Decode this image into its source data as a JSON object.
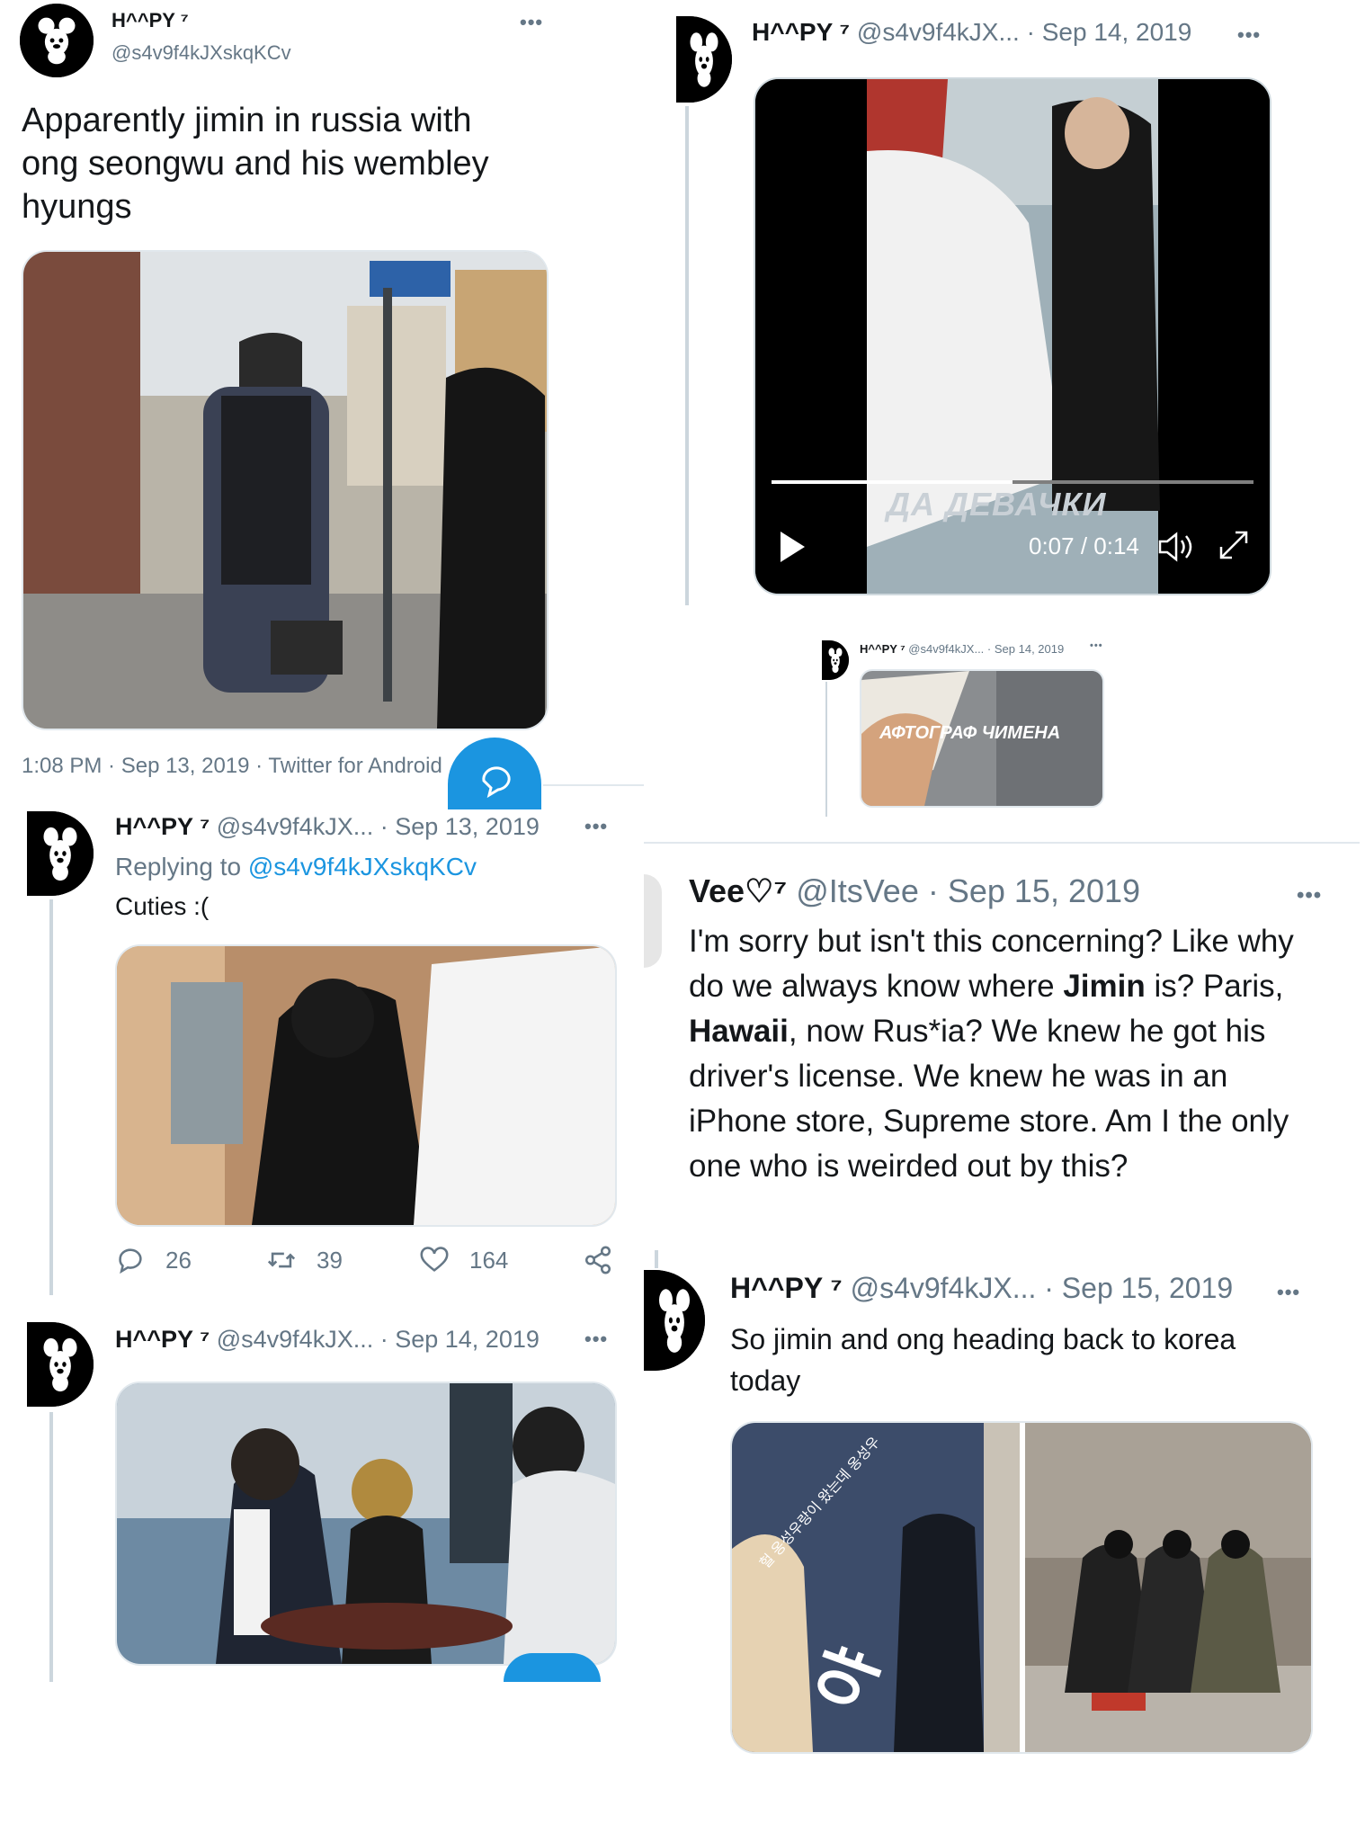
{
  "tweet_main": {
    "display_name": "H^^PY ⁷",
    "handle": "@s4v9f4kJXskqKCv",
    "text_lines": [
      "Apparently jimin in russia with",
      "ong seongwu and his wembley",
      "hyungs"
    ],
    "meta": "1:08 PM · Sep 13, 2019 · Twitter for Android"
  },
  "reply_1": {
    "display_name": "H^^PY ⁷",
    "handle": "@s4v9f4kJX...",
    "date": "· Sep 13, 2019",
    "replying_prefix": "Replying to",
    "replying_handle": "@s4v9f4kJXskqKCv",
    "text": "Cuties :(",
    "replies": "26",
    "retweets": "39",
    "likes": "164"
  },
  "reply_2": {
    "display_name": "H^^PY ⁷",
    "handle": "@s4v9f4kJX...",
    "date": "· Sep 14, 2019"
  },
  "video_tweet": {
    "display_name": "H^^PY ⁷",
    "handle": "@s4v9f4kJX...",
    "date": "· Sep 14, 2019",
    "caption": "ДА ДЕВАЧКИ",
    "time": "0:07 / 0:14",
    "progress": 0.5
  },
  "small_tweet": {
    "header": "H^^PY ⁷",
    "handle": "@s4v9f4kJX...",
    "date": "· Sep 14, 2019",
    "caption": "АФТОГРАФ ЧИМЕНА"
  },
  "vee_tweet": {
    "display_name": "Vee♡⁷",
    "handle": "@ItsVee",
    "date": "· Sep 15, 2019",
    "l1": "I'm sorry but isn't this concerning? Like why",
    "l2_a": "do we always know where ",
    "l2_b": "Jimin",
    "l2_c": " is? Paris,",
    "l3_a": "Hawaii",
    "l3_b": ", now Rus*ia? We knew he got his",
    "l4": "driver's license. We knew he was in an",
    "l5": "iPhone store, Supreme store. Am I the only",
    "l6": "one who is weirded out by this?"
  },
  "last_tweet": {
    "display_name": "H^^PY ⁷",
    "handle": "@s4v9f4kJX...",
    "date": "· Sep 15, 2019",
    "text_lines": [
      "So jimin and ong heading back to korea",
      "today"
    ],
    "overlay_korean": "헐 옹성우랑이 왔는데 옹성우",
    "overlay_big": "야"
  },
  "icons": [
    "mickey-avatar-icon",
    "more-options-icon",
    "reply-icon",
    "retweet-icon",
    "like-icon",
    "share-icon",
    "play-icon",
    "volume-icon",
    "fullscreen-icon",
    "compose-fab-icon"
  ],
  "colors": {
    "accent": "#1b95e0",
    "muted": "#657786",
    "border": "#e1e8ed"
  }
}
